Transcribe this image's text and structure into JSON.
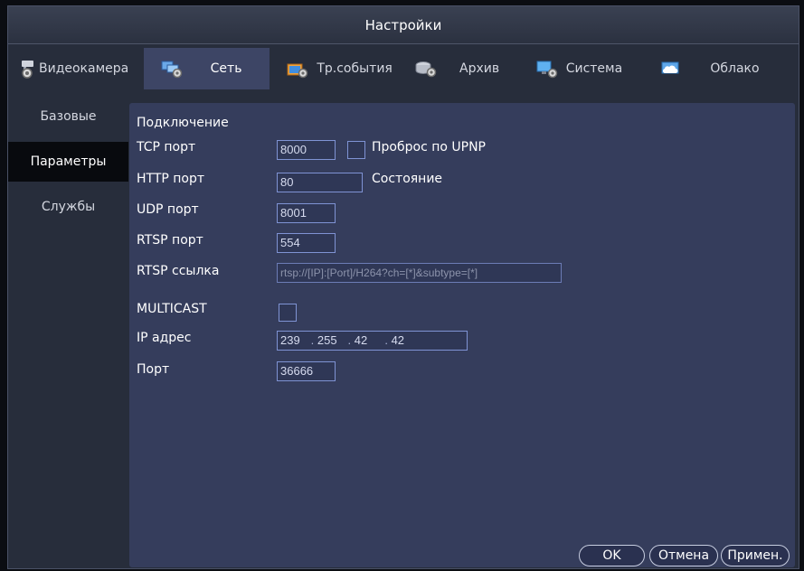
{
  "window": {
    "title": "Настройки"
  },
  "tabs": [
    {
      "label": "Видеокамера",
      "icon": "camera-gear-icon"
    },
    {
      "label": "Сеть",
      "icon": "network-gear-icon"
    },
    {
      "label": "Тр.события",
      "icon": "event-icon"
    },
    {
      "label": "Архив",
      "icon": "archive-icon"
    },
    {
      "label": "Система",
      "icon": "system-gear-icon"
    },
    {
      "label": "Облако",
      "icon": "cloud-icon"
    }
  ],
  "sidebar": {
    "items": [
      {
        "label": "Базовые"
      },
      {
        "label": "Параметры"
      },
      {
        "label": "Службы"
      }
    ]
  },
  "form": {
    "section_title": "Подключение",
    "tcp_port": {
      "label": "TCP порт",
      "value": "8000"
    },
    "upnp": {
      "label": "Проброс по UPNP",
      "checked": false
    },
    "http_port": {
      "label": "HTTP порт",
      "value": "80"
    },
    "status": {
      "label": "Состояние"
    },
    "udp_port": {
      "label": "UDP порт",
      "value": "8001"
    },
    "rtsp_port": {
      "label": "RTSP порт",
      "value": "554"
    },
    "rtsp_url": {
      "label": "RTSP ссылка",
      "value": "rtsp://[IP]:[Port]/H264?ch=[*]&subtype=[*]"
    },
    "multicast": {
      "label": "MULTICAST",
      "checked": false
    },
    "ip_address": {
      "label": "IP адрес",
      "octets": [
        "239",
        "255",
        "42",
        "42"
      ]
    },
    "port": {
      "label": "Порт",
      "value": "36666"
    }
  },
  "buttons": {
    "ok": "OK",
    "cancel": "Отмена",
    "apply": "Примен."
  },
  "colors": {
    "background": "#272d3b",
    "panel": "#353d5c",
    "active_tab": "#3d4565",
    "field_border": "#7f93d4"
  }
}
